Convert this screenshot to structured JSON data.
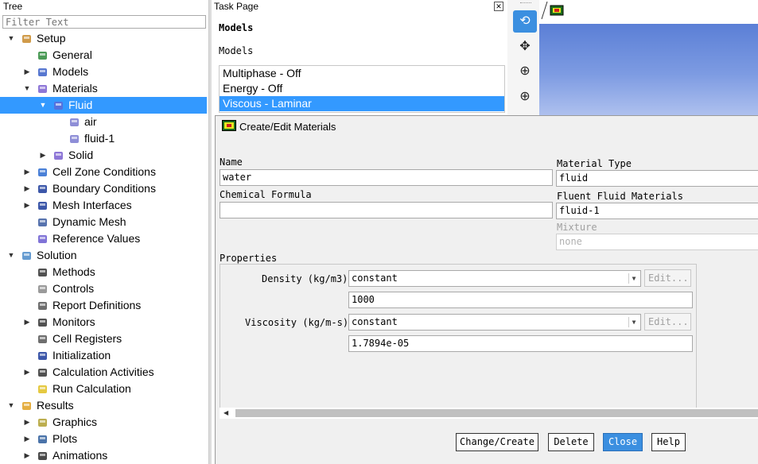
{
  "tree": {
    "header": "Tree",
    "filter_placeholder": "Filter Text",
    "items": [
      {
        "label": "Setup",
        "icon": "setup-icon",
        "expander": "▼"
      },
      {
        "label": "General",
        "icon": "general-icon",
        "expander": ""
      },
      {
        "label": "Models",
        "icon": "models-icon",
        "expander": "▶"
      },
      {
        "label": "Materials",
        "icon": "materials-icon",
        "expander": "▼"
      },
      {
        "label": "Fluid",
        "icon": "flask-icon",
        "expander": "▼"
      },
      {
        "label": "air",
        "icon": "flask-icon",
        "expander": ""
      },
      {
        "label": "fluid-1",
        "icon": "flask-icon",
        "expander": ""
      },
      {
        "label": "Solid",
        "icon": "flask-icon",
        "expander": "▶"
      },
      {
        "label": "Cell Zone Conditions",
        "icon": "cell-zone-icon",
        "expander": "▶"
      },
      {
        "label": "Boundary Conditions",
        "icon": "boundary-icon",
        "expander": "▶"
      },
      {
        "label": "Mesh Interfaces",
        "icon": "mesh-interfaces-icon",
        "expander": "▶"
      },
      {
        "label": "Dynamic Mesh",
        "icon": "dynamic-mesh-icon",
        "expander": ""
      },
      {
        "label": "Reference Values",
        "icon": "reference-values-icon",
        "expander": ""
      },
      {
        "label": "Solution",
        "icon": "solution-icon",
        "expander": "▼"
      },
      {
        "label": "Methods",
        "icon": "methods-icon",
        "expander": ""
      },
      {
        "label": "Controls",
        "icon": "controls-icon",
        "expander": ""
      },
      {
        "label": "Report Definitions",
        "icon": "report-definitions-icon",
        "expander": ""
      },
      {
        "label": "Monitors",
        "icon": "monitors-icon",
        "expander": "▶"
      },
      {
        "label": "Cell Registers",
        "icon": "cell-registers-icon",
        "expander": ""
      },
      {
        "label": "Initialization",
        "icon": "initialization-icon",
        "expander": ""
      },
      {
        "label": "Calculation Activities",
        "icon": "calculation-activities-icon",
        "expander": "▶"
      },
      {
        "label": "Run Calculation",
        "icon": "run-calculation-icon",
        "expander": ""
      },
      {
        "label": "Results",
        "icon": "results-icon",
        "expander": "▼"
      },
      {
        "label": "Graphics",
        "icon": "graphics-icon",
        "expander": "▶"
      },
      {
        "label": "Plots",
        "icon": "plots-icon",
        "expander": "▶"
      },
      {
        "label": "Animations",
        "icon": "animations-icon",
        "expander": "▶"
      }
    ]
  },
  "task_page": {
    "header": "Task Page",
    "close_glyph": "✕",
    "section_title": "Models",
    "models_label": "Models",
    "models": [
      "Multiphase - Off",
      "Energy - Off",
      "Viscous - Laminar"
    ]
  },
  "toolbar": {
    "rotate_glyph": "⟲",
    "pan_glyph": "✥",
    "zoom_glyph": "⊕",
    "zoom_box_glyph": "⊕"
  },
  "dialog": {
    "title": "Create/Edit Materials",
    "name_label": "Name",
    "name_value": "water",
    "chemical_formula_label": "Chemical Formula",
    "chemical_formula_value": "",
    "material_type_label": "Material Type",
    "material_type_value": "fluid",
    "fluent_materials_label": "Fluent Fluid Materials",
    "fluent_materials_value": "fluid-1",
    "mixture_label": "Mixture",
    "mixture_value": "none",
    "properties_label": "Properties",
    "density_label": "Density (kg/m3)",
    "density_method": "constant",
    "density_value": "1000",
    "viscosity_label": "Viscosity (kg/m-s)",
    "viscosity_method": "constant",
    "viscosity_value": "1.7894e-05",
    "edit_label": "Edit...",
    "scroll_left_glyph": "◀",
    "buttons": {
      "change_create": "Change/Create",
      "delete": "Delete",
      "close": "Close",
      "help": "Help"
    }
  },
  "colors": {
    "selection": "#3399ff",
    "accent_button": "#3b8fe0"
  }
}
